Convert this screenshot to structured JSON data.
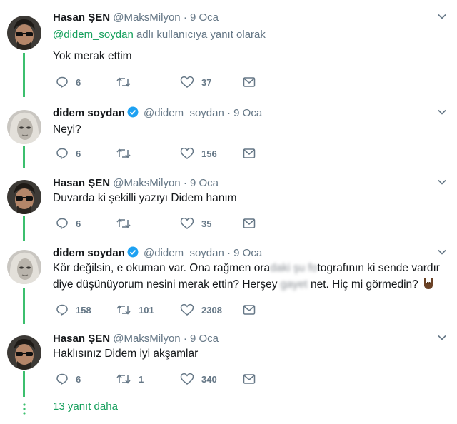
{
  "tweets": [
    {
      "name": "Hasan ŞEN",
      "handle": "@MaksMilyon",
      "dot": "·",
      "time": "9 Oca",
      "verified": false,
      "reply_mention": "@didem_soydan",
      "reply_text": " adlı kullanıcıya yanıt olarak",
      "text": "Yok merak ettim",
      "replies": "6",
      "retweets": "",
      "likes": "37"
    },
    {
      "name": "didem soydan",
      "handle": "@didem_soydan",
      "dot": "·",
      "time": "9 Oca",
      "verified": true,
      "text": "Neyi?",
      "replies": "6",
      "retweets": "",
      "likes": "156"
    },
    {
      "name": "Hasan ŞEN",
      "handle": "@MaksMilyon",
      "dot": "·",
      "time": "9 Oca",
      "verified": false,
      "text": "Duvarda ki şekilli yazıyı Didem hanım",
      "replies": "6",
      "retweets": "",
      "likes": "35"
    },
    {
      "name": "didem soydan",
      "handle": "@didem_soydan",
      "dot": "·",
      "time": "9 Oca",
      "verified": true,
      "text_parts": {
        "a": "Kör değilsin, e okuman var. Ona rağmen ora",
        "b": "daki şu fo",
        "c": "tografının ki sende vardır",
        "d": "diye düşünüyorum nesini merak ettin? Herşey ",
        "e": "gayet",
        "f": " net. Hiç mi görmedin?"
      },
      "emoji": "horns-hand-emoji",
      "replies": "158",
      "retweets": "101",
      "likes": "2308"
    },
    {
      "name": "Hasan ŞEN",
      "handle": "@MaksMilyon",
      "dot": "·",
      "time": "9 Oca",
      "verified": false,
      "text": "Haklısınız Didem iyi akşamlar",
      "replies": "6",
      "retweets": "1",
      "likes": "340"
    }
  ],
  "more_replies": "13 yanıt daha",
  "colors": {
    "thread_line": "#3cbf6e",
    "link_green": "#17a05d",
    "muted": "#657786",
    "verified": "#1da1f2"
  },
  "icons": [
    "reply-icon",
    "retweet-icon",
    "like-icon",
    "message-icon",
    "chevron-down-icon",
    "verified-badge-icon"
  ]
}
